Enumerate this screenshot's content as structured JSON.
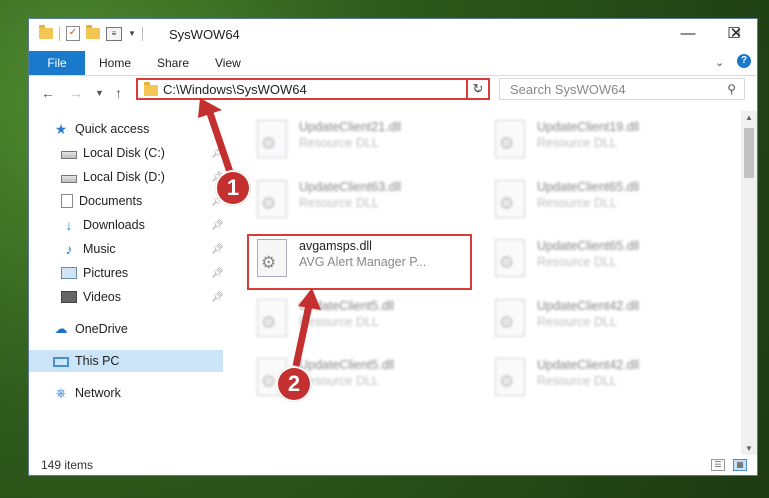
{
  "window": {
    "title": "SysWOW64"
  },
  "title_controls": {
    "minimize": "—",
    "maximize": "☐",
    "close": "✕"
  },
  "ribbon": {
    "file": "File",
    "home": "Home",
    "share": "Share",
    "view": "View",
    "help": "?"
  },
  "address": {
    "path": "C:\\Windows\\SysWOW64"
  },
  "search": {
    "placeholder": "Search SysWOW64"
  },
  "sidebar": {
    "quick_access": "Quick access",
    "items": [
      {
        "label": "Local Disk (C:)",
        "icon": "disk-icon"
      },
      {
        "label": "Local Disk (D:)",
        "icon": "disk-icon"
      },
      {
        "label": "Documents",
        "icon": "documents-icon"
      },
      {
        "label": "Downloads",
        "icon": "downloads-icon"
      },
      {
        "label": "Music",
        "icon": "music-icon"
      },
      {
        "label": "Pictures",
        "icon": "pictures-icon"
      },
      {
        "label": "Videos",
        "icon": "videos-icon"
      }
    ],
    "onedrive": "OneDrive",
    "this_pc": "This PC",
    "network": "Network"
  },
  "files": [
    {
      "name": "UpdateClient21.dll",
      "desc": "Resource DLL"
    },
    {
      "name": "UpdateClient19.dll",
      "desc": "Resource DLL"
    },
    {
      "name": "UpdateClient63.dll",
      "desc": "Resource DLL"
    },
    {
      "name": "UpdateClient65.dll",
      "desc": "Resource DLL"
    },
    {
      "name": "avgamsps.dll",
      "desc": "AVG Alert Manager P..."
    },
    {
      "name": "UpdateClient65.dll",
      "desc": "Resource DLL"
    },
    {
      "name": "UpdateClient5.dll",
      "desc": "Resource DLL"
    },
    {
      "name": "UpdateClient42.dll",
      "desc": "Resource DLL"
    },
    {
      "name": "UpdateClient5.dll",
      "desc": "Resource DLL"
    },
    {
      "name": "UpdateClient42.dll",
      "desc": "Resource DLL"
    }
  ],
  "status": {
    "items": "149 items"
  },
  "annotations": {
    "step1": "1",
    "step2": "2",
    "color": "#c42f2f"
  }
}
